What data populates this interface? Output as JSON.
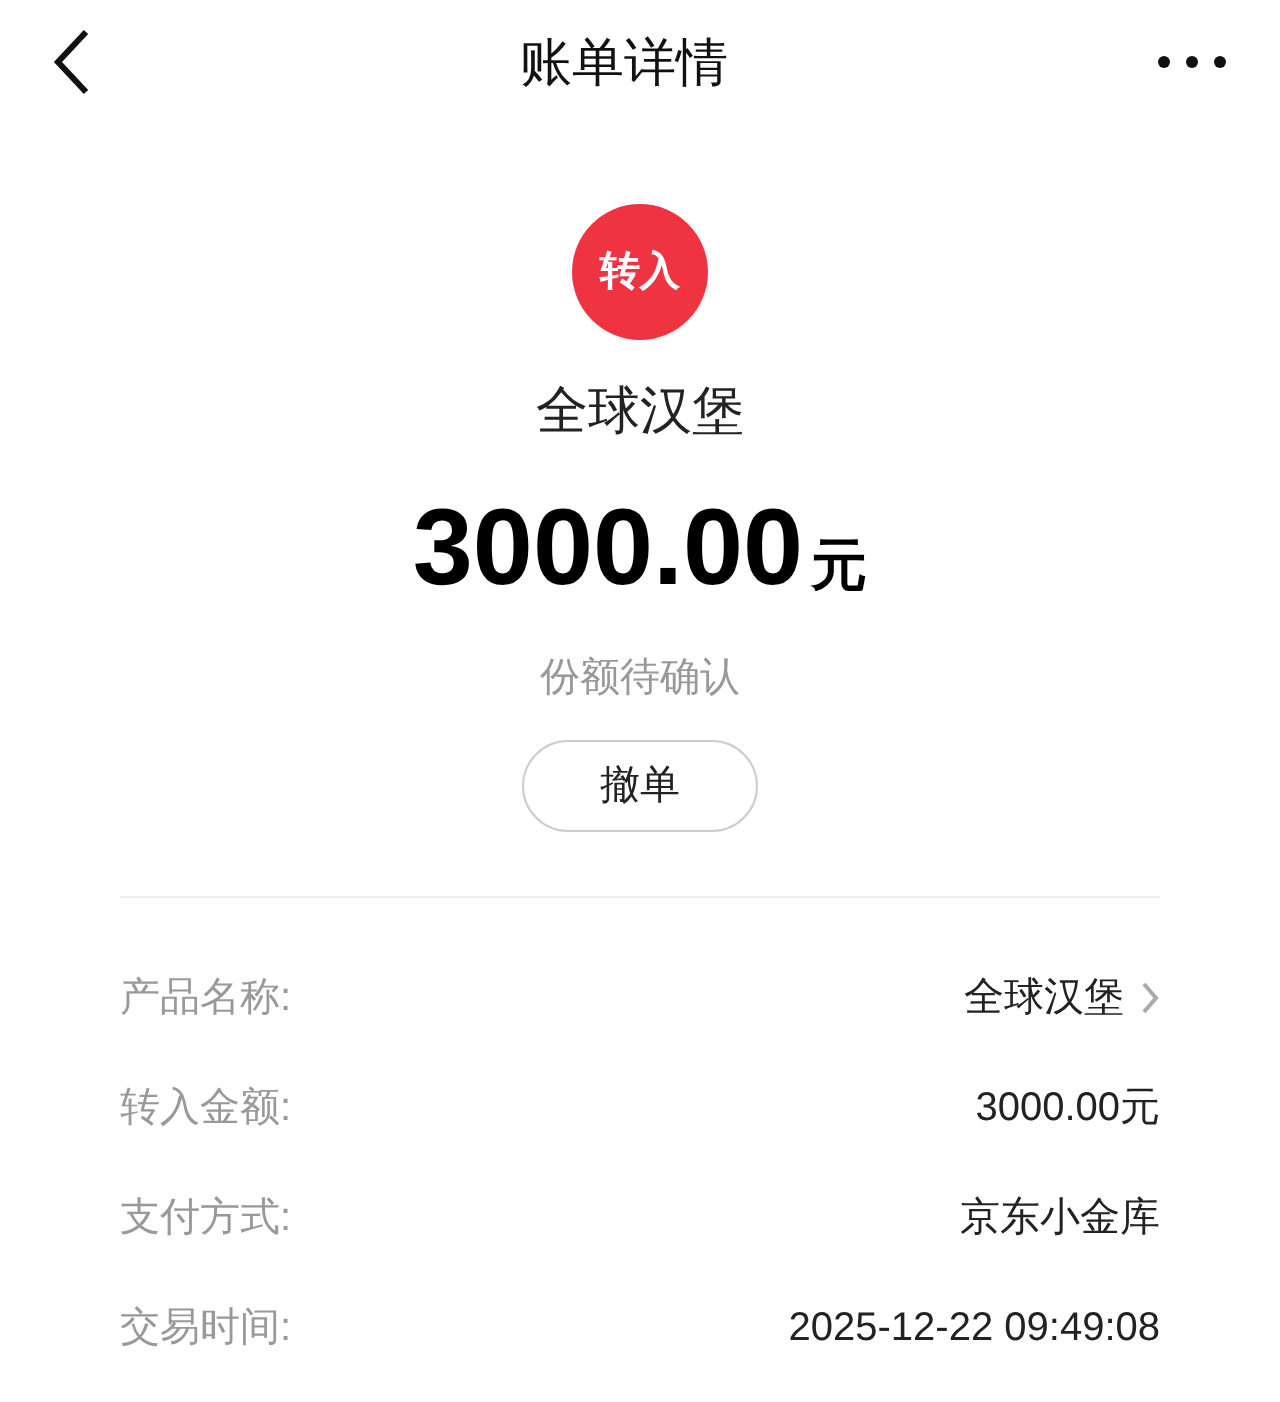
{
  "header": {
    "title": "账单详情"
  },
  "badge": {
    "label": "转入",
    "color": "#ef3340"
  },
  "product": "全球汉堡",
  "amount": {
    "value": "3000.00",
    "unit": "元"
  },
  "status": "份额待确认",
  "action_button": "撤单",
  "details": [
    {
      "kind": "link",
      "label": "产品名称:",
      "value": "全球汉堡"
    },
    {
      "kind": "plain",
      "label": "转入金额:",
      "value": "3000.00元"
    },
    {
      "kind": "plain",
      "label": "支付方式:",
      "value": "京东小金库"
    },
    {
      "kind": "plain",
      "label": "交易时间:",
      "value": "2025-12-22 09:49:08"
    }
  ]
}
